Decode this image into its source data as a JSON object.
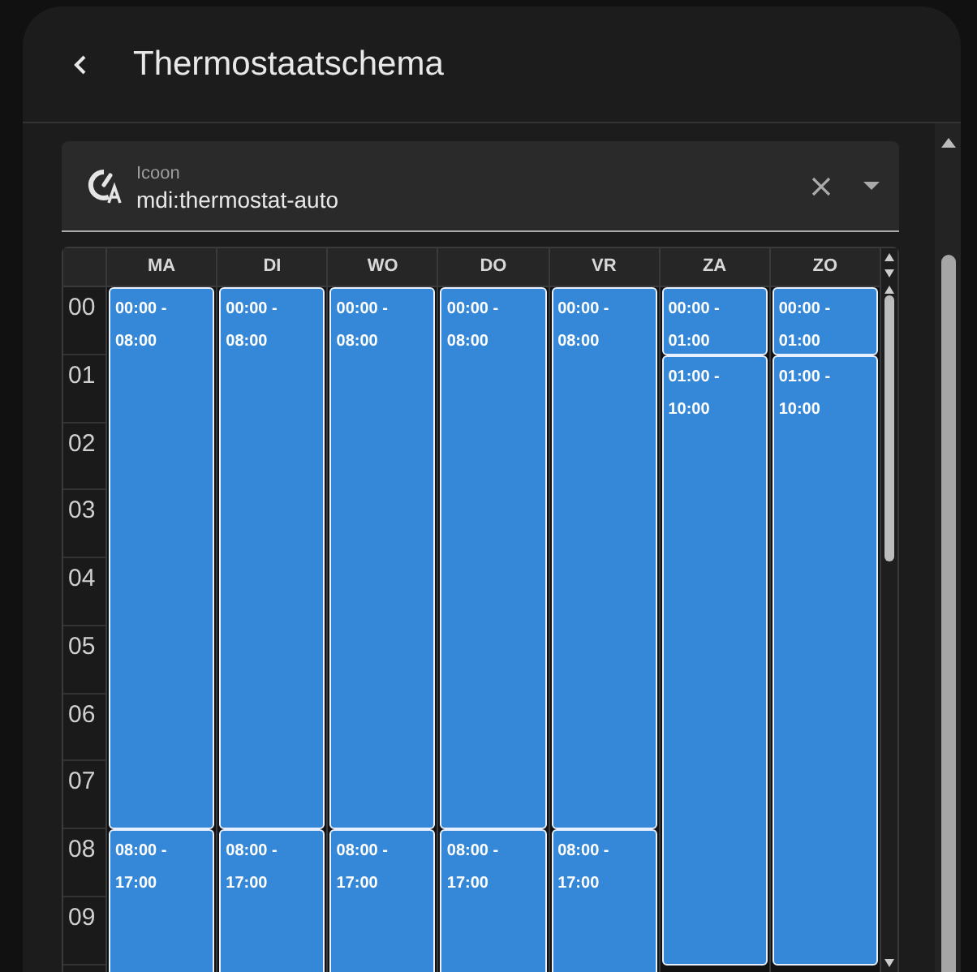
{
  "dialog": {
    "title": "Thermostaatschema"
  },
  "icon_field": {
    "label": "Icoon",
    "value": "mdi:thermostat-auto"
  },
  "schedule": {
    "hours": [
      "00",
      "01",
      "02",
      "03",
      "04",
      "05",
      "06",
      "07",
      "08",
      "09"
    ],
    "days": [
      {
        "label": "MA",
        "events": [
          {
            "start": "00:00 -",
            "end": "08:00"
          },
          {
            "start": "08:00 -",
            "end": "17:00"
          }
        ]
      },
      {
        "label": "DI",
        "events": [
          {
            "start": "00:00 -",
            "end": "08:00"
          },
          {
            "start": "08:00 -",
            "end": "17:00"
          }
        ]
      },
      {
        "label": "WO",
        "events": [
          {
            "start": "00:00 -",
            "end": "08:00"
          },
          {
            "start": "08:00 -",
            "end": "17:00"
          }
        ]
      },
      {
        "label": "DO",
        "events": [
          {
            "start": "00:00 -",
            "end": "08:00"
          },
          {
            "start": "08:00 -",
            "end": "17:00"
          }
        ]
      },
      {
        "label": "VR",
        "events": [
          {
            "start": "00:00 -",
            "end": "08:00"
          },
          {
            "start": "08:00 -",
            "end": "17:00"
          }
        ]
      },
      {
        "label": "ZA",
        "events": [
          {
            "start": "00:00 -",
            "end": "01:00"
          },
          {
            "start": "01:00 -",
            "end": "10:00"
          }
        ]
      },
      {
        "label": "ZO",
        "events": [
          {
            "start": "00:00 -",
            "end": "01:00"
          },
          {
            "start": "01:00 -",
            "end": "10:00"
          }
        ]
      }
    ]
  }
}
